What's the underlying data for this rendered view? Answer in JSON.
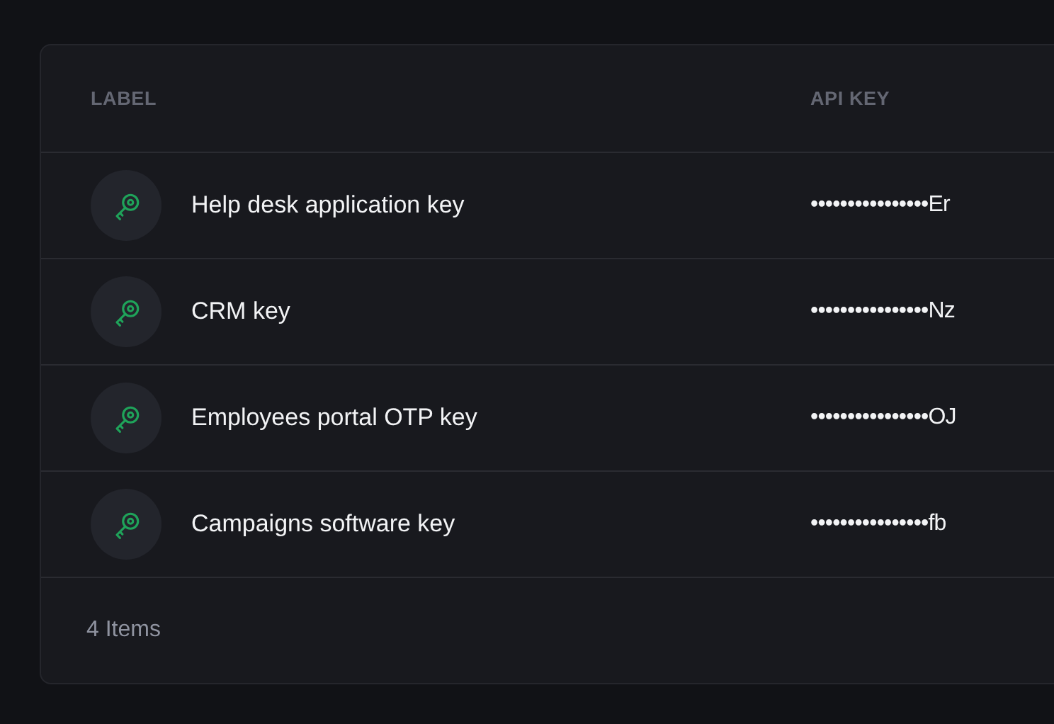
{
  "table": {
    "columns": [
      "LABEL",
      "API KEY"
    ],
    "rows": [
      {
        "label": "Help desk application key",
        "api_key": "••••••••••••••••Er"
      },
      {
        "label": "CRM key",
        "api_key": "••••••••••••••••Nz"
      },
      {
        "label": "Employees portal OTP key",
        "api_key": "••••••••••••••••OJ"
      },
      {
        "label": "Campaigns software key",
        "api_key": "••••••••••••••••fb"
      }
    ],
    "footer": "4 Items"
  }
}
